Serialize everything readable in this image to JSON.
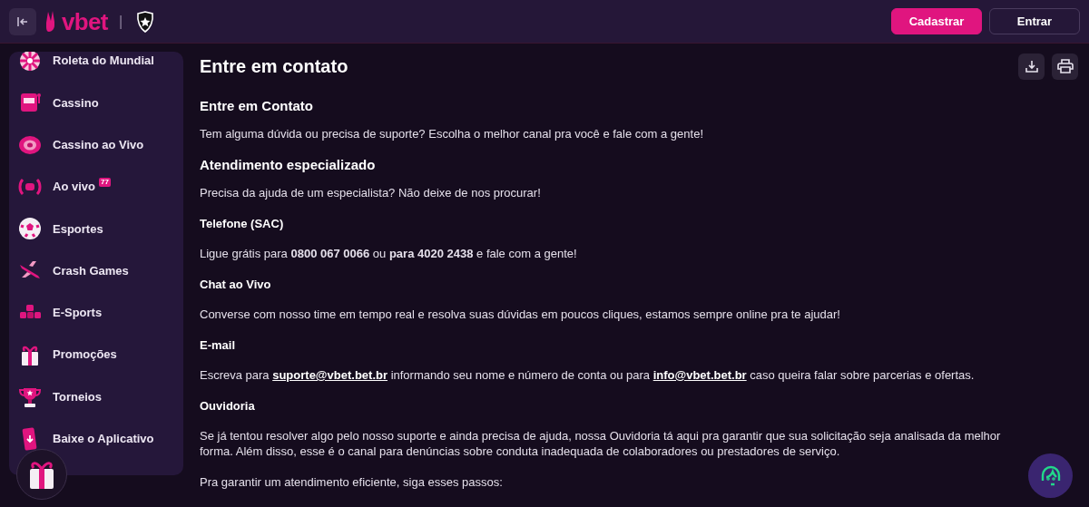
{
  "header": {
    "logo": "vbet",
    "separator": "|",
    "buttons": [
      {
        "label": "Cadastrar",
        "kind": "primary"
      },
      {
        "label": "Entrar",
        "kind": "outline"
      }
    ]
  },
  "sidebar": {
    "items": [
      {
        "label": "Roleta do Mundial"
      },
      {
        "label": "Cassino"
      },
      {
        "label": "Cassino ao Vivo"
      },
      {
        "label": "Ao vivo",
        "badge": "77"
      },
      {
        "label": "Esportes"
      },
      {
        "label": "Crash Games"
      },
      {
        "label": "E-Sports"
      },
      {
        "label": "Promoções"
      },
      {
        "label": "Torneios"
      },
      {
        "label": "Baixe o Aplicativo"
      }
    ]
  },
  "page": {
    "title": "Entre em contato",
    "blocks": [
      {
        "kind": "heading",
        "text": "Entre em Contato"
      },
      {
        "kind": "paragraph",
        "parts": [
          {
            "kind": "text",
            "text": "Tem alguma dúvida ou precisa de suporte? Escolha o melhor canal pra você e fale com a gente!"
          }
        ]
      },
      {
        "kind": "heading",
        "text": "Atendimento especializado"
      },
      {
        "kind": "paragraph",
        "parts": [
          {
            "kind": "text",
            "text": "Precisa da ajuda de um especialista? Não deixe de nos procurar!"
          }
        ]
      },
      {
        "kind": "subheading",
        "text": "Telefone (SAC)"
      },
      {
        "kind": "paragraph",
        "parts": [
          {
            "kind": "text",
            "text": "Ligue grátis para **0800 067 0066** ou **para 4020 2438** e fale com a gente!"
          }
        ]
      },
      {
        "kind": "subheading",
        "text": "Chat ao Vivo"
      },
      {
        "kind": "paragraph",
        "parts": [
          {
            "kind": "text",
            "text": "Converse com nosso time em tempo real e resolva suas dúvidas em poucos cliques, estamos sempre online pra te ajudar!"
          }
        ]
      },
      {
        "kind": "subheading",
        "text": "E-mail"
      },
      {
        "kind": "paragraph",
        "parts": [
          {
            "kind": "text",
            "text": "Escreva para "
          },
          {
            "kind": "link",
            "text": "suporte@vbet.bet.br"
          },
          {
            "kind": "text",
            "text": " informando seu nome e número de conta ou para "
          },
          {
            "kind": "link",
            "text": "info@vbet.bet.br"
          },
          {
            "kind": "text",
            "text": " caso queira falar sobre parcerias e ofertas."
          }
        ]
      },
      {
        "kind": "subheading",
        "text": "Ouvidoria"
      },
      {
        "kind": "paragraph",
        "parts": [
          {
            "kind": "text",
            "text": "Se já tentou resolver algo pelo nosso suporte e ainda precisa de ajuda, nossa Ouvidoria tá aqui pra garantir que sua solicitação seja analisada da melhor forma. Além disso, esse é o canal para denúncias sobre conduta inadequada de colaboradores ou prestadores de serviço."
          }
        ]
      },
      {
        "kind": "paragraph",
        "parts": [
          {
            "kind": "text",
            "text": "Pra garantir um atendimento eficiente, siga esses passos:"
          }
        ]
      }
    ]
  }
}
